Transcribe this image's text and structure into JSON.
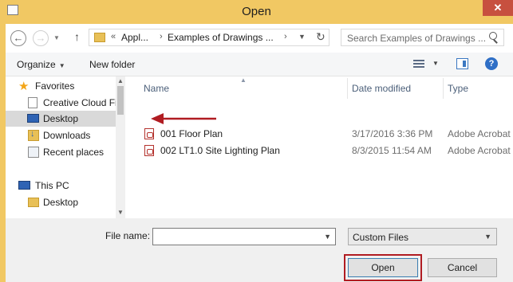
{
  "window": {
    "title": "Open",
    "close_glyph": "✕"
  },
  "address_bar": {
    "back_glyph": "←",
    "forward_glyph": "→",
    "up_glyph": "↑",
    "segments": [
      "«",
      "Appl...",
      "›",
      "Examples of Drawings ...",
      "›"
    ],
    "search_placeholder": "Search Examples of Drawings ..."
  },
  "toolbar": {
    "organize_label": "Organize",
    "new_folder_label": "New folder",
    "help_glyph": "?"
  },
  "nav": {
    "items": [
      {
        "label": "Favorites",
        "icon": "star-icon"
      },
      {
        "label": "Creative Cloud Fi",
        "icon": "document-icon"
      },
      {
        "label": "Desktop",
        "icon": "desktop-icon",
        "selected": true
      },
      {
        "label": "Downloads",
        "icon": "downloads-icon"
      },
      {
        "label": "Recent places",
        "icon": "recent-places-icon"
      },
      {
        "label": "This PC",
        "icon": "computer-icon"
      },
      {
        "label": "Desktop",
        "icon": "folder-icon"
      }
    ]
  },
  "file_list": {
    "columns": [
      "Name",
      "Date modified",
      "Type"
    ],
    "rows": [
      {
        "name": "001 Floor Plan",
        "date": "3/17/2016 3:36 PM",
        "type": "Adobe Acrobat",
        "icon": "pdf-icon"
      },
      {
        "name": "002 LT1.0 Site Lighting Plan",
        "date": "8/3/2015 11:54 AM",
        "type": "Adobe Acrobat",
        "icon": "pdf-icon"
      }
    ]
  },
  "annotation": {
    "arrow_color": "#b01c22"
  },
  "bottom": {
    "file_name_label": "File name:",
    "file_name_value": "",
    "filter_value": "Custom Files",
    "open_label": "Open",
    "cancel_label": "Cancel"
  },
  "colors": {
    "titlebar": "#f1c863",
    "close_button": "#c7503f",
    "highlight_outline": "#b01c22"
  }
}
